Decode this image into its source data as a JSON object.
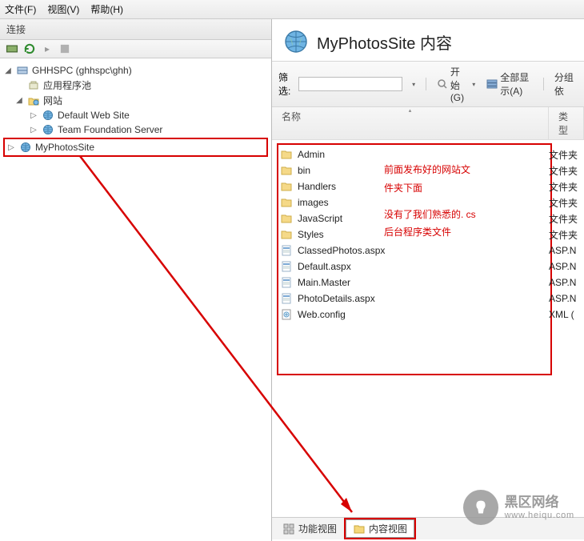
{
  "menu": {
    "file": "文件(F)",
    "view": "视图(V)",
    "help": "帮助(H)"
  },
  "left_panel": {
    "title": "连接",
    "tree": {
      "root": "GHHSPC (ghhspc\\ghh)",
      "apppool": "应用程序池",
      "sites": "网站",
      "site1": "Default Web Site",
      "site2": "Team Foundation Server",
      "site3": "MyPhotosSite"
    }
  },
  "right_panel": {
    "title": "MyPhotosSite 内容",
    "filter_label": "筛选:",
    "go_label": "开始(G)",
    "showall_label": "全部显示(A)",
    "groupby_label": "分组依",
    "col_name": "名称",
    "col_type": "类型",
    "files": [
      {
        "name": "Admin",
        "type": "文件夹",
        "kind": "folder"
      },
      {
        "name": "bin",
        "type": "文件夹",
        "kind": "folder"
      },
      {
        "name": "Handlers",
        "type": "文件夹",
        "kind": "folder"
      },
      {
        "name": "images",
        "type": "文件夹",
        "kind": "folder"
      },
      {
        "name": "JavaScript",
        "type": "文件夹",
        "kind": "folder"
      },
      {
        "name": "Styles",
        "type": "文件夹",
        "kind": "folder"
      },
      {
        "name": "ClassedPhotos.aspx",
        "type": "ASP.N",
        "kind": "aspx"
      },
      {
        "name": "Default.aspx",
        "type": "ASP.N",
        "kind": "aspx"
      },
      {
        "name": "Main.Master",
        "type": "ASP.N",
        "kind": "aspx"
      },
      {
        "name": "PhotoDetails.aspx",
        "type": "ASP.N",
        "kind": "aspx"
      },
      {
        "name": "Web.config",
        "type": "XML (",
        "kind": "xml"
      }
    ],
    "annotation": {
      "l1": "前面发布好的网站文",
      "l2": "件夹下面",
      "l3": "没有了我们熟悉的. cs",
      "l4": " 后台程序类文件"
    }
  },
  "footer": {
    "tab1": "功能视图",
    "tab2": "内容视图"
  },
  "watermark": {
    "line1": "黑区网络",
    "line2": "www.heiqu.com"
  }
}
